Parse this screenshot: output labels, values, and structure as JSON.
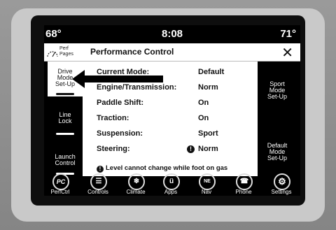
{
  "status_bar": {
    "temp_left": "68°",
    "time": "8:08",
    "temp_right": "71°"
  },
  "header": {
    "perf_pages_line1": "Perf",
    "perf_pages_line2": "Pages",
    "title": "Performance Control",
    "close_icon": "close-icon",
    "close_glyph": "✕"
  },
  "left_buttons": [
    {
      "line1": "Drive",
      "line2": "Mode",
      "line3": "Set-Up"
    },
    {
      "line1": "Line",
      "line2": "Lock"
    },
    {
      "line1": "Launch",
      "line2": "Control"
    }
  ],
  "right_buttons": [
    {
      "line1": "Sport",
      "line2": "Mode",
      "line3": "Set-Up"
    },
    {
      "line1": "Default",
      "line2": "Mode",
      "line3": "Set-Up"
    }
  ],
  "settings": [
    {
      "key": "Current Mode:",
      "value": "Default"
    },
    {
      "key": "Engine/Transmission:",
      "value": "Norm"
    },
    {
      "key": "Paddle Shift:",
      "value": "On"
    },
    {
      "key": "Traction:",
      "value": "On"
    },
    {
      "key": "Suspension:",
      "value": "Sport"
    },
    {
      "key": "Steering:",
      "value": "Norm",
      "warning": "!"
    }
  ],
  "note": {
    "icon": "!",
    "text": "Level cannot change while foot on gas"
  },
  "dock": [
    {
      "icon": "perfctrl-icon",
      "glyph": "PC",
      "label": "PerfCtrl"
    },
    {
      "icon": "controls-icon",
      "glyph": "☰",
      "label": "Controls"
    },
    {
      "icon": "climate-icon",
      "glyph": "❄",
      "label": "Climate"
    },
    {
      "icon": "apps-icon",
      "glyph": "ü",
      "label": "Apps"
    },
    {
      "icon": "nav-compass-icon",
      "glyph": "NE",
      "label": "Nav"
    },
    {
      "icon": "phone-icon",
      "glyph": "☎",
      "label": "Phone"
    },
    {
      "icon": "settings-gear-icon",
      "glyph": "⚙",
      "label": "Settings"
    }
  ],
  "colors": {
    "screen_bg": "#000000",
    "content_bg": "#ffffff",
    "text": "#111111"
  }
}
